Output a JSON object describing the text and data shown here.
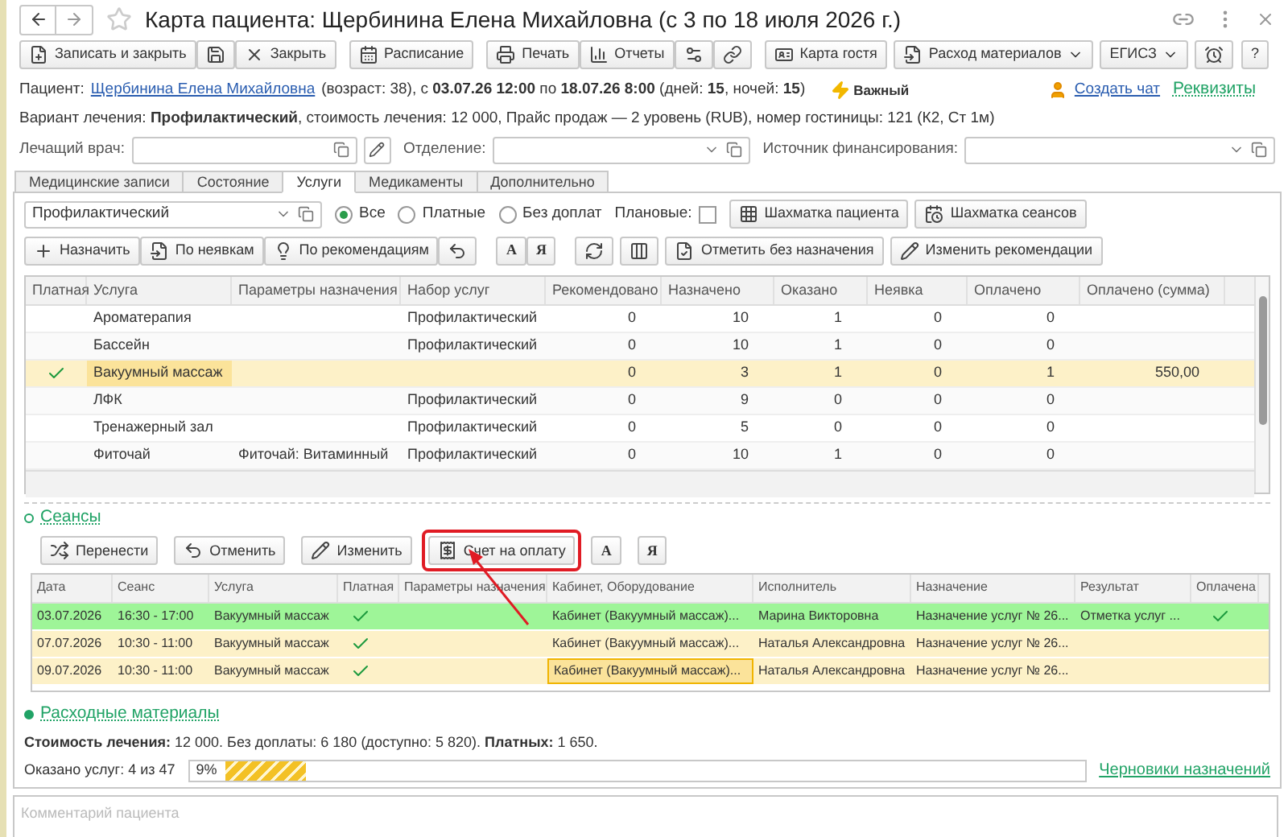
{
  "window": {
    "title": "Карта пациента: Щербинина Елена Михайловна (с 3 по 18 июля 2026 г.)"
  },
  "toolbar": {
    "save_close": "Записать и закрыть",
    "close": "Закрыть",
    "schedule": "Расписание",
    "print": "Печать",
    "reports": "Отчеты",
    "guest_card": "Карта гостя",
    "materials": "Расход материалов",
    "egisz": "ЕГИСЗ",
    "help": "?"
  },
  "patient": {
    "label": "Пациент:",
    "name": "Щербинина Елена Михайловна",
    "details": "(возраст: 38), с **03.07.26 12:00** по **18.07.26 8:00** (дней: **15**, ночей: **15**)",
    "important": "Важный",
    "create_chat": "Создать чат",
    "requisites": "Реквизиты"
  },
  "treatment": "Вариант лечения: **Профилактический**, стоимость лечения: 12 000, Прайс продаж — 2 уровень (RUB), номер гостиницы: 121 (К2, Ст 1м)",
  "fields": {
    "doctor": "Лечащий врач:",
    "department": "Отделение:",
    "funding": "Источник финансирования:"
  },
  "tabs": [
    {
      "label": "Медицинские записи",
      "selected": false
    },
    {
      "label": "Состояние",
      "selected": false
    },
    {
      "label": "Услуги",
      "selected": true
    },
    {
      "label": "Медикаменты",
      "selected": false
    },
    {
      "label": "Дополнительно",
      "selected": false
    }
  ],
  "filter": {
    "value": "Профилактический",
    "radios": [
      {
        "label": "Все",
        "selected": true
      },
      {
        "label": "Платные",
        "selected": false
      },
      {
        "label": "Без доплат",
        "selected": false
      }
    ],
    "planned": {
      "label": "Плановые:",
      "checked": false
    },
    "patient_chess": "Шахматка пациента",
    "seance_chess": "Шахматка сеансов"
  },
  "services_toolbar": {
    "assign": "Назначить",
    "no_shows": "По неявкам",
    "recommendations": "По рекомендациям",
    "sort_asc": "А",
    "sort_desc": "Я",
    "mark": "Отметить без назначения",
    "change_rec": "Изменить рекомендации"
  },
  "services": {
    "columns": [
      "Платная",
      "Услуга",
      "Параметры назначения",
      "Набор услуг",
      "Рекомендовано",
      "Назначено",
      "Оказано",
      "Неявка",
      "Оплачено",
      "Оплачено (сумма)"
    ],
    "rows": [
      {
        "paid": false,
        "service": "Ароматерапия",
        "set": "Профилактический",
        "recommended": "0",
        "assigned": "10",
        "done": "1",
        "no_show": "0",
        "paid_count": "0",
        "selected": false
      },
      {
        "paid": false,
        "service": "Бассейн",
        "set": "Профилактический",
        "recommended": "0",
        "assigned": "10",
        "done": "1",
        "no_show": "0",
        "paid_count": "0",
        "selected": false
      },
      {
        "paid": true,
        "service": "Вакуумный массаж",
        "recommended": "0",
        "assigned": "3",
        "done": "1",
        "no_show": "0",
        "paid_count": "1",
        "paid_sum": "550,00",
        "selected": true
      },
      {
        "paid": false,
        "service": "ЛФК",
        "set": "Профилактический",
        "recommended": "0",
        "assigned": "9",
        "done": "0",
        "no_show": "0",
        "paid_count": "0",
        "selected": false
      },
      {
        "paid": false,
        "service": "Тренажерный зал",
        "set": "Профилактический",
        "recommended": "0",
        "assigned": "5",
        "done": "0",
        "no_show": "0",
        "paid_count": "0",
        "selected": false
      },
      {
        "paid": false,
        "service": "Фиточай",
        "params": "Фиточай: Витаминный",
        "set": "Профилактический",
        "recommended": "0",
        "assigned": "10",
        "done": "1",
        "no_show": "0",
        "paid_count": "0",
        "selected": false
      }
    ]
  },
  "sections": [
    {
      "title": "Сеансы",
      "expanded": true
    },
    {
      "title": "Расходные материалы",
      "expanded": false
    }
  ],
  "seance_toolbar": [
    {
      "label": "Перенести",
      "highlighted": false
    },
    {
      "label": "Отменить",
      "highlighted": false
    },
    {
      "label": "Изменить",
      "highlighted": false
    },
    {
      "label": "Счет на оплату",
      "highlighted": true
    },
    {
      "label": "А",
      "highlighted": false
    },
    {
      "label": "Я",
      "highlighted": false
    }
  ],
  "seances": {
    "columns": [
      "Дата",
      "Сеанс",
      "Услуга",
      "Платная",
      "Параметры назначения",
      "Кабинет, Оборудование",
      "Исполнитель",
      "Назначение",
      "Результат",
      "Оплачена"
    ],
    "rows": [
      {
        "date": "03.07.2026",
        "time": "16:30 - 17:00",
        "service": "Вакуумный массаж",
        "paid": true,
        "room": "Кабинет (Вакуумный массаж)...",
        "performer": "Марина Викторовна",
        "assignment": "Назначение услуг № 26...",
        "result": "Отметка услуг ...",
        "settled": true,
        "color": "#9ef598",
        "focused": false
      },
      {
        "date": "07.07.2026",
        "time": "10:30 - 11:00",
        "service": "Вакуумный массаж",
        "paid": true,
        "room": "Кабинет (Вакуумный массаж)...",
        "performer": "Наталья Александровна",
        "assignment": "Назначение услуг № 26...",
        "settled": false,
        "color": "#fdf1c8",
        "focused": false
      },
      {
        "date": "09.07.2026",
        "time": "10:30 - 11:00",
        "service": "Вакуумный массаж",
        "paid": true,
        "room": "Кабинет (Вакуумный массаж)...",
        "performer": "Наталья Александровна",
        "assignment": "Назначение услуг № 26...",
        "settled": false,
        "color": "#fdf1c8",
        "focused": true
      }
    ]
  },
  "summary": "**Стоимость лечения:** 12 000. Без доплаты: 6 180 (доступно: 5 820). **Платных:** 1 650.",
  "progress": {
    "label": "Оказано услуг: 4 из 47",
    "reading": "9%",
    "level": 0.09
  },
  "drafts": "Черновики назначений",
  "comment": {
    "placeholder": "Комментарий пациента"
  }
}
